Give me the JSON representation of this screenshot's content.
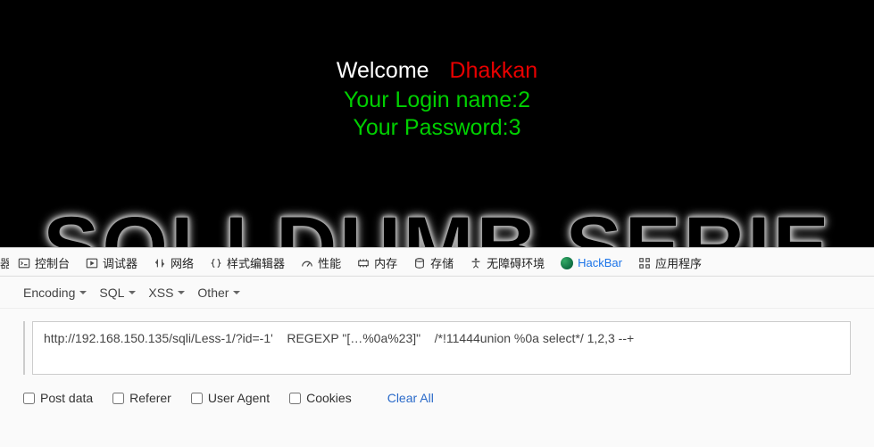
{
  "page": {
    "welcome": "Welcome",
    "dhakkan": "Dhakkan",
    "login_name": "Your Login name:2",
    "password": "Your Password:3",
    "bg_text": "SQLI DUMB SERIE"
  },
  "devtools": {
    "tabs": {
      "truncated": "器",
      "console": "控制台",
      "debugger": "调试器",
      "network": "网络",
      "style": "样式编辑器",
      "perf": "性能",
      "memory": "内存",
      "storage": "存储",
      "a11y": "无障碍环境",
      "hackbar": "HackBar",
      "apps": "应用程序"
    }
  },
  "hackbar": {
    "menus": {
      "encoding": "Encoding",
      "sql": "SQL",
      "xss": "XSS",
      "other": "Other"
    },
    "url_value": "http://192.168.150.135/sqli/Less-1/?id=-1'    REGEXP \"[…%0a%23]\"    /*!11444union %0a select*/ 1,2,3 --+",
    "checks": {
      "post": "Post data",
      "referer": "Referer",
      "ua": "User Agent",
      "cookies": "Cookies"
    },
    "clear": "Clear All"
  }
}
